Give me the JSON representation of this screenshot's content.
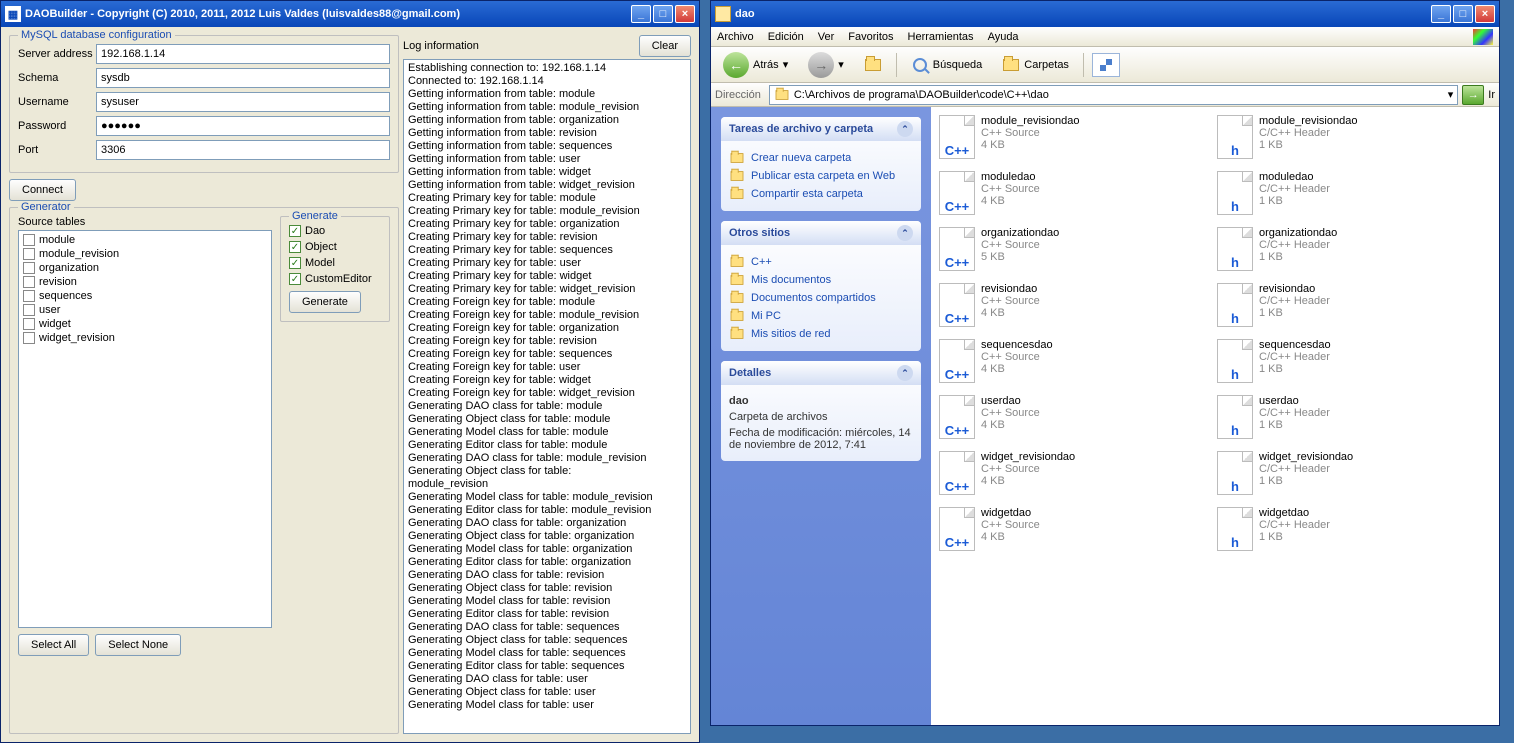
{
  "win1": {
    "title": "DAOBuilder - Copyright (C) 2010, 2011, 2012 Luis Valdes (luisvaldes88@gmail.com)",
    "group_db": "MySQL database configuration",
    "server_label": "Server address",
    "server_value": "192.168.1.14",
    "schema_label": "Schema",
    "schema_value": "sysdb",
    "username_label": "Username",
    "username_value": "sysuser",
    "password_label": "Password",
    "password_value": "●●●●●●",
    "port_label": "Port",
    "port_value": "3306",
    "connect_btn": "Connect",
    "group_gen": "Generator",
    "source_tables_label": "Source tables",
    "tables": [
      "module",
      "module_revision",
      "organization",
      "revision",
      "sequences",
      "user",
      "widget",
      "widget_revision"
    ],
    "generate_label": "Generate",
    "gen_opts": [
      "Dao",
      "Object",
      "Model",
      "CustomEditor"
    ],
    "generate_btn": "Generate",
    "select_all": "Select All",
    "select_none": "Select None",
    "log_label": "Log information",
    "clear_btn": "Clear",
    "log": "Establishing connection to: 192.168.1.14\nConnected to: 192.168.1.14\nGetting information from table: module\nGetting information from table: module_revision\nGetting information from table: organization\nGetting information from table: revision\nGetting information from table: sequences\nGetting information from table: user\nGetting information from table: widget\nGetting information from table: widget_revision\nCreating Primary key for table: module\nCreating Primary key for table: module_revision\nCreating Primary key for table: organization\nCreating Primary key for table: revision\nCreating Primary key for table: sequences\nCreating Primary key for table: user\nCreating Primary key for table: widget\nCreating Primary key for table: widget_revision\nCreating Foreign key for table: module\nCreating Foreign key for table: module_revision\nCreating Foreign key for table: organization\nCreating Foreign key for table: revision\nCreating Foreign key for table: sequences\nCreating Foreign key for table: user\nCreating Foreign key for table: widget\nCreating Foreign key for table: widget_revision\nGenerating DAO class for table: module\nGenerating Object class for table: module\nGenerating Model class for table: module\nGenerating Editor class for table: module\nGenerating DAO class for table: module_revision\nGenerating Object class for table:\nmodule_revision\nGenerating Model class for table: module_revision\nGenerating Editor class for table: module_revision\nGenerating DAO class for table: organization\nGenerating Object class for table: organization\nGenerating Model class for table: organization\nGenerating Editor class for table: organization\nGenerating DAO class for table: revision\nGenerating Object class for table: revision\nGenerating Model class for table: revision\nGenerating Editor class for table: revision\nGenerating DAO class for table: sequences\nGenerating Object class for table: sequences\nGenerating Model class for table: sequences\nGenerating Editor class for table: sequences\nGenerating DAO class for table: user\nGenerating Object class for table: user\nGenerating Model class for table: user"
  },
  "win2": {
    "title": "dao",
    "menu": [
      "Archivo",
      "Edición",
      "Ver",
      "Favoritos",
      "Herramientas",
      "Ayuda"
    ],
    "back": "Atrás",
    "search": "Búsqueda",
    "folders": "Carpetas",
    "addr_label": "Dirección",
    "addr_value": "C:\\Archivos de programa\\DAOBuilder\\code\\C++\\dao",
    "go": "Ir",
    "task1_title": "Tareas de archivo y carpeta",
    "task1_links": [
      "Crear nueva carpeta",
      "Publicar esta carpeta en Web",
      "Compartir esta carpeta"
    ],
    "task2_title": "Otros sitios",
    "task2_links": [
      "C++",
      "Mis documentos",
      "Documentos compartidos",
      "Mi PC",
      "Mis sitios de red"
    ],
    "task3_title": "Detalles",
    "det_name": "dao",
    "det_type": "Carpeta de archivos",
    "det_mod": "Fecha de modificación: miércoles, 14 de noviembre de 2012, 7:41",
    "type_cpp": "C++ Source",
    "type_h": "C/C++ Header",
    "files": [
      {
        "name": "module_revisiondao",
        "t": "cpp",
        "size": "4 KB"
      },
      {
        "name": "module_revisiondao",
        "t": "h",
        "size": "1 KB"
      },
      {
        "name": "moduledao",
        "t": "cpp",
        "size": "4 KB"
      },
      {
        "name": "moduledao",
        "t": "h",
        "size": "1 KB"
      },
      {
        "name": "organizationdao",
        "t": "cpp",
        "size": "5 KB"
      },
      {
        "name": "organizationdao",
        "t": "h",
        "size": "1 KB"
      },
      {
        "name": "revisiondao",
        "t": "cpp",
        "size": "4 KB"
      },
      {
        "name": "revisiondao",
        "t": "h",
        "size": "1 KB"
      },
      {
        "name": "sequencesdao",
        "t": "cpp",
        "size": "4 KB"
      },
      {
        "name": "sequencesdao",
        "t": "h",
        "size": "1 KB"
      },
      {
        "name": "userdao",
        "t": "cpp",
        "size": "4 KB"
      },
      {
        "name": "userdao",
        "t": "h",
        "size": "1 KB"
      },
      {
        "name": "widget_revisiondao",
        "t": "cpp",
        "size": "4 KB"
      },
      {
        "name": "widget_revisiondao",
        "t": "h",
        "size": "1 KB"
      },
      {
        "name": "widgetdao",
        "t": "cpp",
        "size": "4 KB"
      },
      {
        "name": "widgetdao",
        "t": "h",
        "size": "1 KB"
      }
    ]
  }
}
